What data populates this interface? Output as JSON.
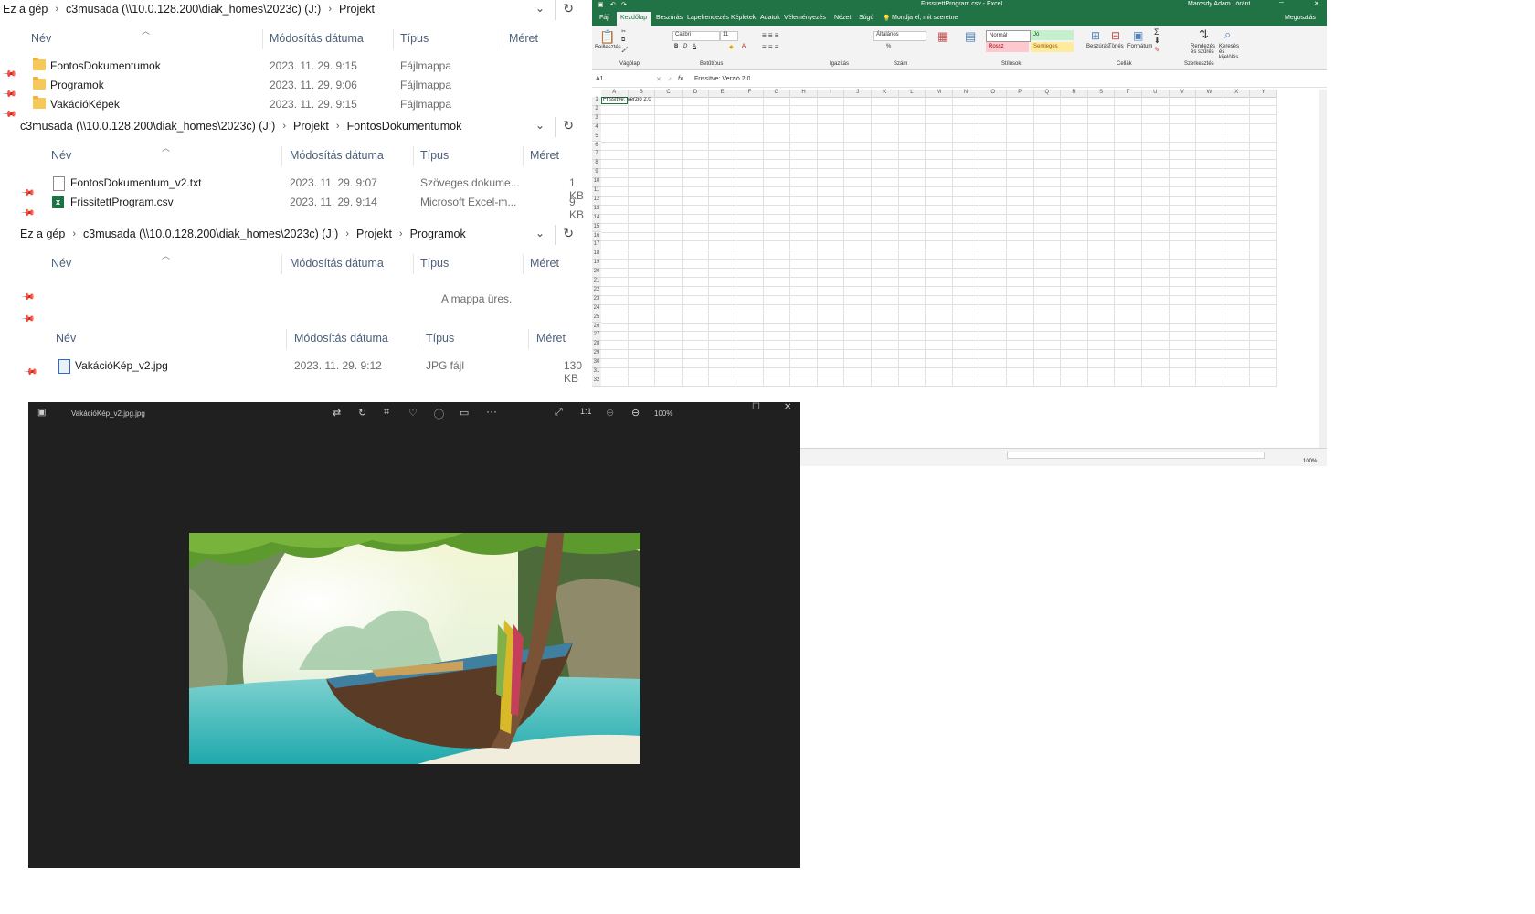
{
  "explorer1": {
    "breadcrumb": [
      "Ez a gép",
      "c3musada (\\\\10.0.128.200\\diak_homes\\2023c) (J:)",
      "Projekt"
    ],
    "columns": {
      "name": "Név",
      "date": "Módosítás dátuma",
      "type": "Típus",
      "size": "Méret"
    },
    "rows": [
      {
        "name": "FontosDokumentumok",
        "date": "2023. 11. 29. 9:15",
        "type": "Fájlmappa"
      },
      {
        "name": "Programok",
        "date": "2023. 11. 29. 9:06",
        "type": "Fájlmappa"
      },
      {
        "name": "VakációKépek",
        "date": "2023. 11. 29. 9:15",
        "type": "Fájlmappa"
      }
    ]
  },
  "explorer2": {
    "breadcrumb": [
      "c3musada (\\\\10.0.128.200\\diak_homes\\2023c) (J:)",
      "Projekt",
      "FontosDokumentumok"
    ],
    "columns": {
      "name": "Név",
      "date": "Módosítás dátuma",
      "type": "Típus",
      "size": "Méret"
    },
    "rows": [
      {
        "name": "FontosDokumentum_v2.txt",
        "date": "2023. 11. 29. 9:07",
        "type": "Szöveges dokume...",
        "size": "1 KB"
      },
      {
        "name": "FrissitettProgram.csv",
        "date": "2023. 11. 29. 9:14",
        "type": "Microsoft Excel-m...",
        "size": "9 KB"
      }
    ]
  },
  "explorer3": {
    "breadcrumb": [
      "Ez a gép",
      "c3musada (\\\\10.0.128.200\\diak_homes\\2023c) (J:)",
      "Projekt",
      "Programok"
    ],
    "columns": {
      "name": "Név",
      "date": "Módosítás dátuma",
      "type": "Típus",
      "size": "Méret"
    },
    "empty_text": "A mappa üres."
  },
  "explorer4": {
    "columns": {
      "name": "Név",
      "date": "Módosítás dátuma",
      "type": "Típus",
      "size": "Méret"
    },
    "rows": [
      {
        "name": "VakációKép_v2.jpg",
        "date": "2023. 11. 29. 9:12",
        "type": "JPG fájl",
        "size": "130 KB"
      }
    ]
  },
  "excel": {
    "title": "FrissitettProgram.csv - Excel",
    "user": "Marosdy Adam Lóránt",
    "tabs": [
      "Fájl",
      "Kezdőlap",
      "Beszúrás",
      "Lapelrendezés",
      "Képletek",
      "Adatok",
      "Véleményezés",
      "Nézet",
      "Súgó",
      "Mondja el, mit szeretne"
    ],
    "share": "Megosztás",
    "ribbon": {
      "paste": "Beillesztés",
      "clipboard": "Vágólap",
      "font_name": "Calibri",
      "font_size": "11",
      "font_group": "Betűtípus",
      "align_group": "Igazítás",
      "number_format": "Általános",
      "number_group": "Szám",
      "styles": {
        "normal": "Normál",
        "jo": "Jó",
        "rossz": "Rossz",
        "semleges": "Semleges"
      },
      "styles_group": "Stílusok",
      "cells_group": "Cellák",
      "edit_group": "Szerkesztés",
      "insert": "Beszúrás",
      "delete": "Törlés",
      "format": "Formátum",
      "sort": "Rendezés és szűrés",
      "find": "Keresés és kijelölés"
    },
    "name_box": "A1",
    "formula": "Frissítve: Verzió 2.0",
    "cell_a1": "Frissítve: Verzió 2.0",
    "columns": [
      "A",
      "B",
      "C",
      "D",
      "E",
      "F",
      "G",
      "H",
      "I",
      "J",
      "K",
      "L",
      "M",
      "N",
      "O",
      "P",
      "Q",
      "R",
      "S",
      "T",
      "U",
      "V",
      "W",
      "X",
      "Y"
    ],
    "rows": [
      "1",
      "2",
      "3",
      "4",
      "5",
      "6",
      "7",
      "8",
      "9",
      "10",
      "11",
      "12",
      "13",
      "14",
      "15",
      "16",
      "17",
      "18",
      "19",
      "20",
      "21",
      "22",
      "23",
      "24",
      "25",
      "26",
      "27",
      "28",
      "29",
      "30",
      "31",
      "32"
    ],
    "zoom": "100%"
  },
  "viewer": {
    "filename": "VakációKép_v2.jpg.jpg",
    "zoom": "100%"
  }
}
